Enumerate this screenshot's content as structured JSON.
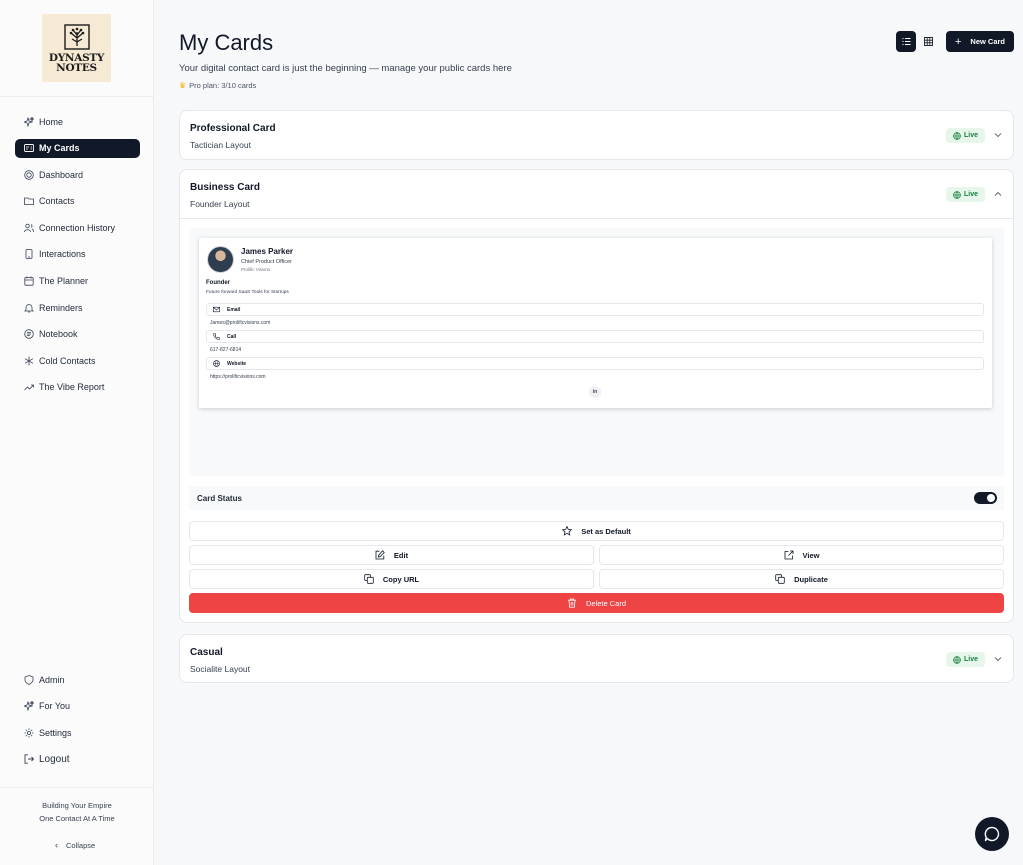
{
  "brand": {
    "logo_line1": "DYNASTY",
    "logo_line2": "NOTES"
  },
  "sidebar": {
    "items": [
      {
        "label": "Home",
        "icon": "sparkle-icon"
      },
      {
        "label": "My Cards",
        "icon": "card-icon",
        "active": true
      },
      {
        "label": "Dashboard",
        "icon": "globe-icon"
      },
      {
        "label": "Contacts",
        "icon": "folder-icon"
      },
      {
        "label": "Connection History",
        "icon": "users-icon"
      },
      {
        "label": "Interactions",
        "icon": "phone-icon"
      },
      {
        "label": "The Planner",
        "icon": "calendar-icon"
      },
      {
        "label": "Reminders",
        "icon": "bell-icon"
      },
      {
        "label": "Notebook",
        "icon": "notebook-icon"
      },
      {
        "label": "Cold Contacts",
        "icon": "snowflake-icon"
      },
      {
        "label": "The Vibe Report",
        "icon": "trending-icon"
      }
    ],
    "bottom_items": [
      {
        "label": "Admin",
        "icon": "shield-icon"
      },
      {
        "label": "For You",
        "icon": "sparkle-icon"
      },
      {
        "label": "Settings",
        "icon": "gear-icon"
      },
      {
        "label": "Logout",
        "icon": "logout-icon"
      }
    ],
    "tagline_line1": "Building Your Empire",
    "tagline_line2": "One Contact At A Time",
    "collapse_label": "Collapse"
  },
  "header": {
    "title": "My Cards",
    "subtitle": "Your digital contact card is just the beginning — manage your public cards here",
    "plan": "Pro plan: 3/10 cards",
    "new_card_label": "New Card"
  },
  "cards": [
    {
      "name": "Professional Card",
      "layout": "Tactician Layout",
      "status": "Live",
      "expanded": false
    },
    {
      "name": "Business Card",
      "layout": "Founder Layout",
      "status": "Live",
      "expanded": true
    },
    {
      "name": "Casual",
      "layout": "Socialite Layout",
      "status": "Live",
      "expanded": false
    }
  ],
  "preview": {
    "name": "James Parker",
    "role": "Chief Product Officer",
    "company": "Prolific Visions",
    "heading": "Founder",
    "tagline": "Future forward SaaS Tools for Startups",
    "email_label": "Email",
    "email_value": "James@prolificvisions.com",
    "call_label": "Call",
    "call_value": "617-827-6814",
    "website_label": "Website",
    "website_value": "https://prolificvisions.com",
    "social": "in"
  },
  "card_status_label": "Card Status",
  "card_status_on": true,
  "actions": {
    "set_default": "Set as Default",
    "edit": "Edit",
    "view": "View",
    "copy_url": "Copy URL",
    "duplicate": "Duplicate",
    "delete": "Delete Card"
  },
  "colors": {
    "accent": "#111827",
    "live_bg": "#e7f6ea",
    "live_text": "#15803d",
    "danger": "#ef4444",
    "logo_bg": "#f6ead4"
  }
}
